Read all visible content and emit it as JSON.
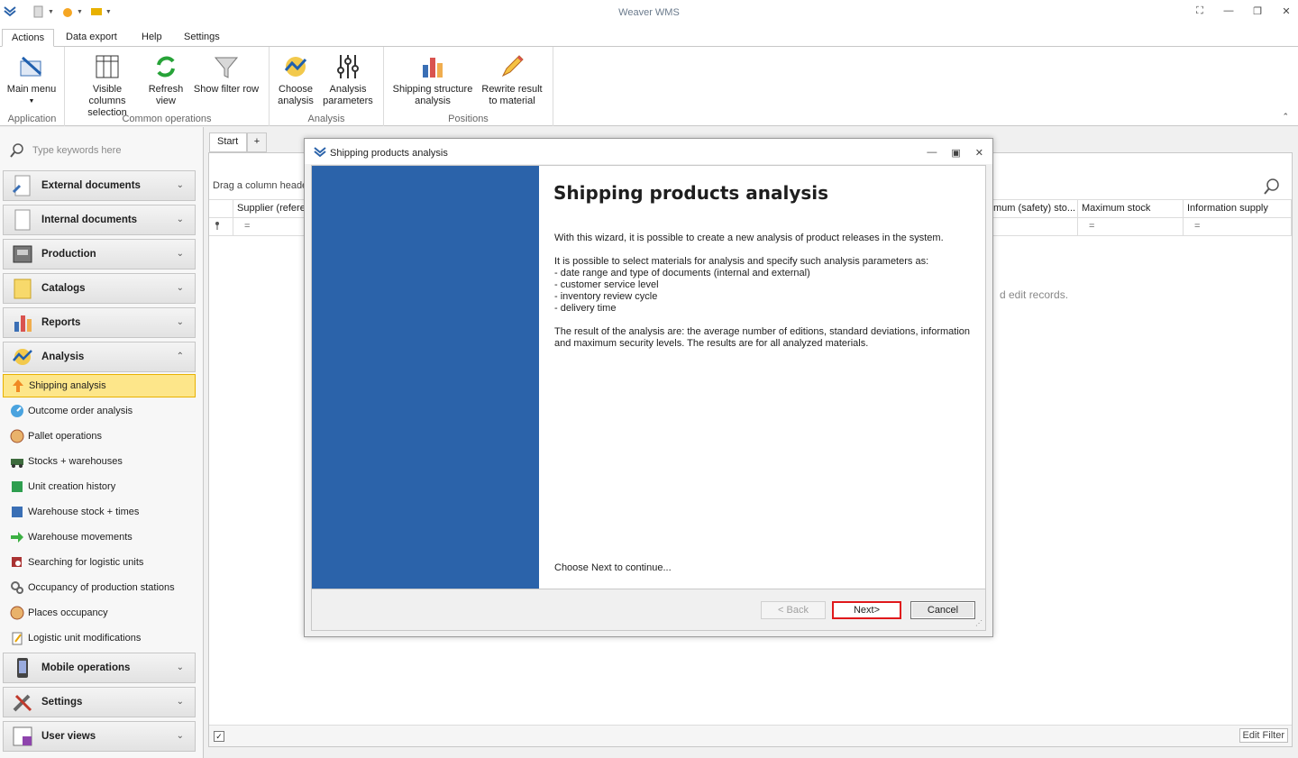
{
  "app": {
    "title": "Weaver WMS"
  },
  "ribbon_tabs": [
    "Actions",
    "Data export",
    "Help",
    "Settings"
  ],
  "ribbon": {
    "groups": [
      {
        "label": "Application",
        "buttons": [
          {
            "label": "Main menu",
            "icon": "main-menu-icon"
          }
        ]
      },
      {
        "label": "Common operations",
        "buttons": [
          {
            "label": "Visible columns selection",
            "icon": "columns-icon"
          },
          {
            "label": "Refresh view",
            "icon": "refresh-icon"
          },
          {
            "label": "Show filter row",
            "icon": "filter-icon"
          }
        ]
      },
      {
        "label": "Analysis",
        "buttons": [
          {
            "label": "Choose analysis",
            "icon": "analysis-icon"
          },
          {
            "label": "Analysis parameters",
            "icon": "parameters-icon"
          }
        ]
      },
      {
        "label": "Positions",
        "buttons": [
          {
            "label": "Shipping structure analysis",
            "icon": "bar-chart-icon"
          },
          {
            "label": "Rewrite result to material",
            "icon": "pencil-icon"
          }
        ]
      }
    ]
  },
  "nav": {
    "search_placeholder": "Type keywords here",
    "groups_top": [
      "External documents",
      "Internal documents",
      "Production",
      "Catalogs",
      "Reports",
      "Analysis"
    ],
    "analysis_items": [
      "Shipping analysis",
      "Outcome order analysis",
      "Pallet operations",
      "Stocks + warehouses",
      "Unit creation history",
      "Warehouse stock + times",
      "Warehouse movements",
      "Searching for logistic units",
      "Occupancy of production stations",
      "Places occupancy",
      "Logistic unit modifications"
    ],
    "groups_bottom": [
      "Mobile operations",
      "Settings",
      "User views"
    ]
  },
  "doc_tabs": {
    "start": "Start",
    "add": "+"
  },
  "grid": {
    "group_hint": "Drag a column heade",
    "columns_left": [
      "Supplier (refere"
    ],
    "columns_right": [
      "mum (safety) sto...",
      "Maximum stock",
      "Information supply"
    ],
    "filter_op": "=",
    "empty_tail": "d  edit records.",
    "checkbox": "✓",
    "edit_filter": "Edit Filter"
  },
  "dialog": {
    "title": "Shipping products analysis",
    "heading": "Shipping products analysis",
    "intro": "With this wizard, it is possible to create a new analysis of product releases in the system.",
    "params_intro": "It is possible to select materials for analysis and specify such analysis parameters as:",
    "params": [
      "- date range and type of documents (internal and external)",
      "- customer service level",
      "- inventory review cycle",
      "- delivery time"
    ],
    "result": "The result of the analysis are: the average number of editions, standard deviations, information and maximum security levels. The results are for all analyzed materials.",
    "continue": "Choose Next to continue...",
    "back": "< Back",
    "next": "Next>",
    "cancel": "Cancel"
  },
  "colors": {
    "accent_blue": "#2b63aa",
    "highlight": "#fde68a",
    "next_border": "#e0181b"
  }
}
